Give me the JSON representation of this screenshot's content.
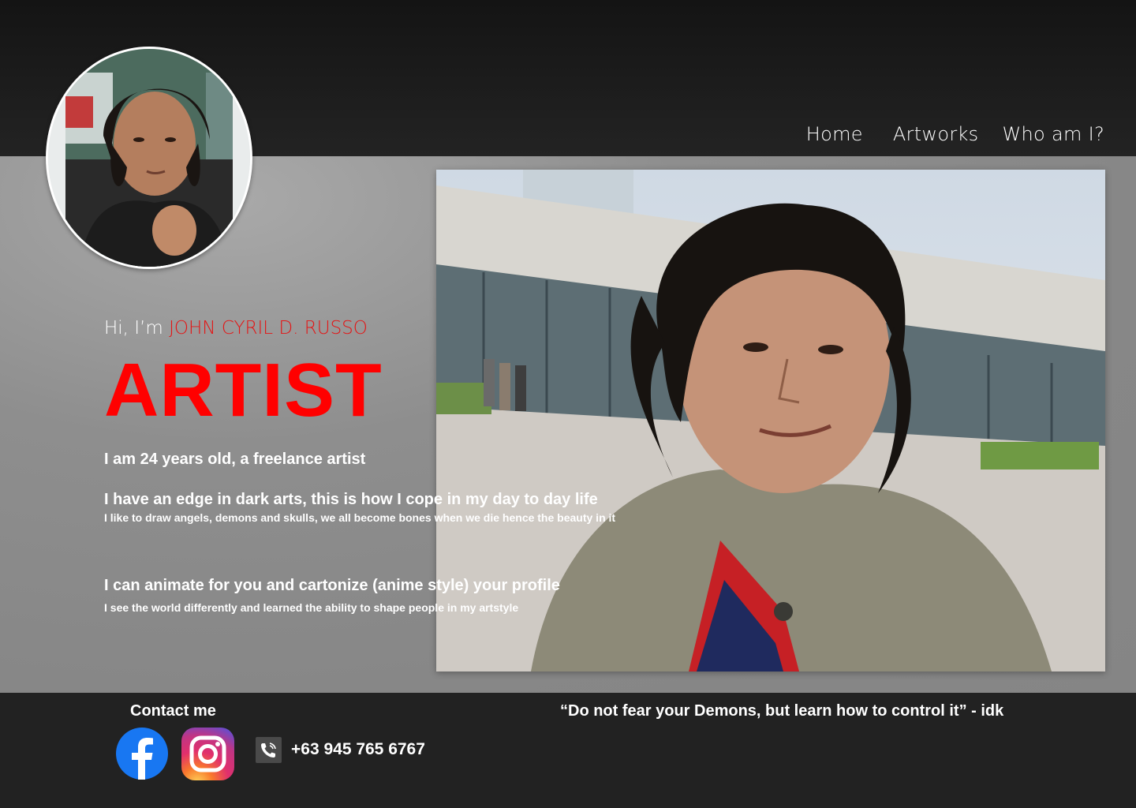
{
  "nav": {
    "items": [
      {
        "label": "Home"
      },
      {
        "label": "Artworks"
      },
      {
        "label": "Who am I?"
      }
    ]
  },
  "hero": {
    "greeting": "Hi, I’m ",
    "name": "JOHN CYRIL D. RUSSO",
    "role": "ARTIST",
    "lines": [
      "I am 24 years old, a freelance artist",
      "I have an edge in dark arts, this is how I cope in my day to day life",
      "I like to draw angels, demons and skulls, we all become bones when we die hence the beauty in it",
      "I can animate for you and cartonize (anime style) your profile",
      "I see the world differently and learned the ability to shape people in my artstyle"
    ]
  },
  "footer": {
    "contact_title": "Contact me",
    "phone": "+63 945 765 6767",
    "quote": "“Do not fear your Demons, but learn how to control it” - idk"
  },
  "colors": {
    "accent": "#ff0000",
    "facebook": "#1877f2",
    "topbar": "#1a1a1a",
    "footer": "#222222"
  },
  "icons": [
    "facebook-icon",
    "instagram-icon",
    "phone-icon"
  ]
}
